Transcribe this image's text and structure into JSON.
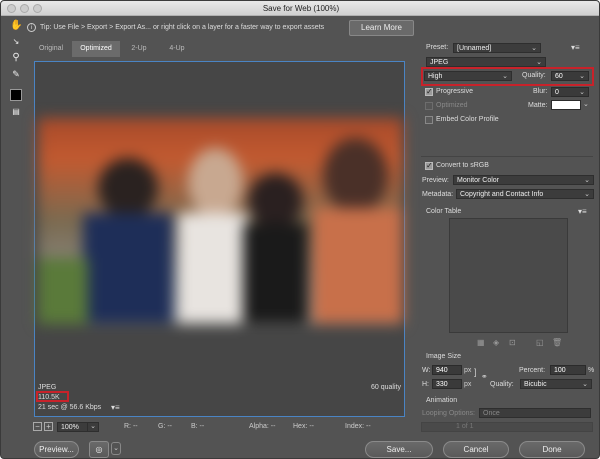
{
  "window": {
    "title": "Save for Web (100%)"
  },
  "tip": {
    "text": "Tip: Use File > Export > Export As... or right click on a layer for a faster way to export assets",
    "learn_more": "Learn More"
  },
  "tabs": [
    {
      "label": "Original"
    },
    {
      "label": "Optimized"
    },
    {
      "label": "2-Up"
    },
    {
      "label": "4-Up"
    }
  ],
  "preview_info": {
    "format": "JPEG",
    "size": "110.5K",
    "time": "21 sec @ 56.6 Kbps",
    "quality": "60 quality"
  },
  "status": {
    "zoom": "100%",
    "r": "R: --",
    "g": "G: --",
    "b": "B: --",
    "alpha": "Alpha: --",
    "hex": "Hex: --",
    "index": "Index: --"
  },
  "buttons": {
    "preview": "Preview...",
    "save": "Save...",
    "cancel": "Cancel",
    "done": "Done"
  },
  "settings": {
    "preset_label": "Preset:",
    "preset_value": "[Unnamed]",
    "format": "JPEG",
    "quality_level": "High",
    "quality_label": "Quality:",
    "quality_value": "60",
    "progressive": "Progressive",
    "blur_label": "Blur:",
    "blur_value": "0",
    "optimized": "Optimized",
    "matte_label": "Matte:",
    "embed_profile": "Embed Color Profile",
    "convert_srgb": "Convert to sRGB",
    "preview_label": "Preview:",
    "preview_value": "Monitor Color",
    "metadata_label": "Metadata:",
    "metadata_value": "Copyright and Contact Info",
    "color_table": "Color Table",
    "image_size": "Image Size",
    "w_label": "W:",
    "w_value": "940",
    "h_label": "H:",
    "h_value": "330",
    "px": "px",
    "percent_label": "Percent:",
    "percent_value": "100",
    "percent_unit": "%",
    "resample_label": "Quality:",
    "resample_value": "Bicubic",
    "animation": "Animation",
    "looping_label": "Looping Options:",
    "looping_value": "Once",
    "frame_counter": "1 of 1"
  }
}
